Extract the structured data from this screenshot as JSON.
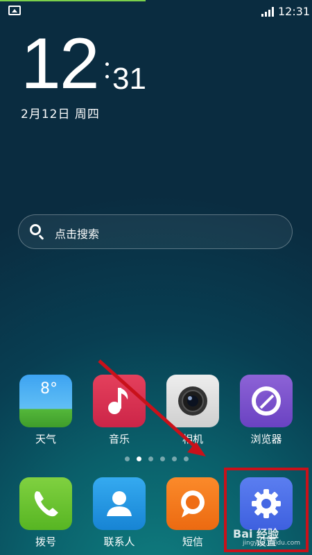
{
  "status_bar": {
    "time": "12:31",
    "left_icon": "gallery-icon",
    "signal_icon": "signal-icon"
  },
  "lock_clock": {
    "hour": "12",
    "minute": "31",
    "date": "2月12日 周四"
  },
  "search": {
    "placeholder": "点击搜索",
    "icon": "search-icon"
  },
  "apps_row1": [
    {
      "label": "天气",
      "icon": "weather-icon",
      "extra": "8°"
    },
    {
      "label": "音乐",
      "icon": "music-note-icon"
    },
    {
      "label": "相机",
      "icon": "camera-icon"
    },
    {
      "label": "浏览器",
      "icon": "browser-icon"
    }
  ],
  "page_indicator": {
    "count": 6,
    "active_index": 1
  },
  "dock": [
    {
      "label": "拨号",
      "icon": "phone-icon"
    },
    {
      "label": "联系人",
      "icon": "contacts-icon"
    },
    {
      "label": "短信",
      "icon": "message-icon"
    },
    {
      "label": "设置",
      "icon": "gear-icon"
    }
  ],
  "annotation": {
    "color": "#c9111a",
    "watermark": "Bai 经验",
    "watermark_sub": "jingyan.baidu.com"
  },
  "colors": {
    "progress": "#7bd14b"
  }
}
